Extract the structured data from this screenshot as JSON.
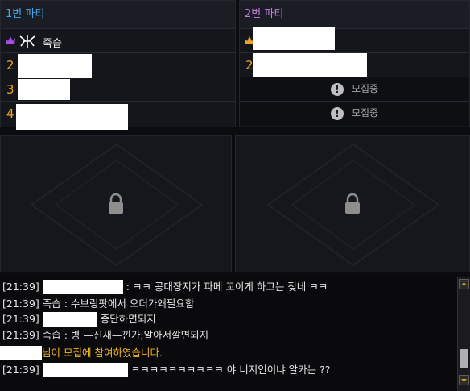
{
  "party1": {
    "title": "1번 파티",
    "leader": {
      "name": "죽습"
    },
    "slots": [
      {
        "num": "2"
      },
      {
        "num": "3"
      },
      {
        "num": "4"
      }
    ]
  },
  "party2": {
    "title": "2번 파티",
    "slots": [
      {
        "num": "2"
      }
    ],
    "recruiting": [
      {
        "label": "모집중"
      },
      {
        "label": "모집중"
      }
    ]
  },
  "chat": [
    {
      "time": "[21:39]",
      "text": ": ㅋㅋ 공대장지가 파메 꼬이게 하고는 짖네 ㅋㅋ"
    },
    {
      "time": "[21:39]",
      "text": "죽습 : 수브링팟에서 오더가왜필요함"
    },
    {
      "time": "[21:39]",
      "text": "중단하면되지"
    },
    {
      "time": "[21:39]",
      "text": "죽습 : 병 —신새—낀가;알아서깔면되지"
    },
    {
      "time": "",
      "text": "님이 모집에 참여하였습니다."
    },
    {
      "time": "[21:39]",
      "text": "ㅋㅋㅋㅋㅋㅋㅋㅋㅋㅋ 야 니지인이냐 알카는 ??"
    }
  ],
  "icons": {
    "leader": "crown-icon",
    "emblem": "guild-emblem-icon",
    "lock": "lock-icon",
    "recruit": "exclamation-icon"
  },
  "colors": {
    "party1_title": "#4aa6e6",
    "party2_title": "#c87de6",
    "slot_number": "#e8a42b",
    "system_message": "#f2b71e"
  }
}
